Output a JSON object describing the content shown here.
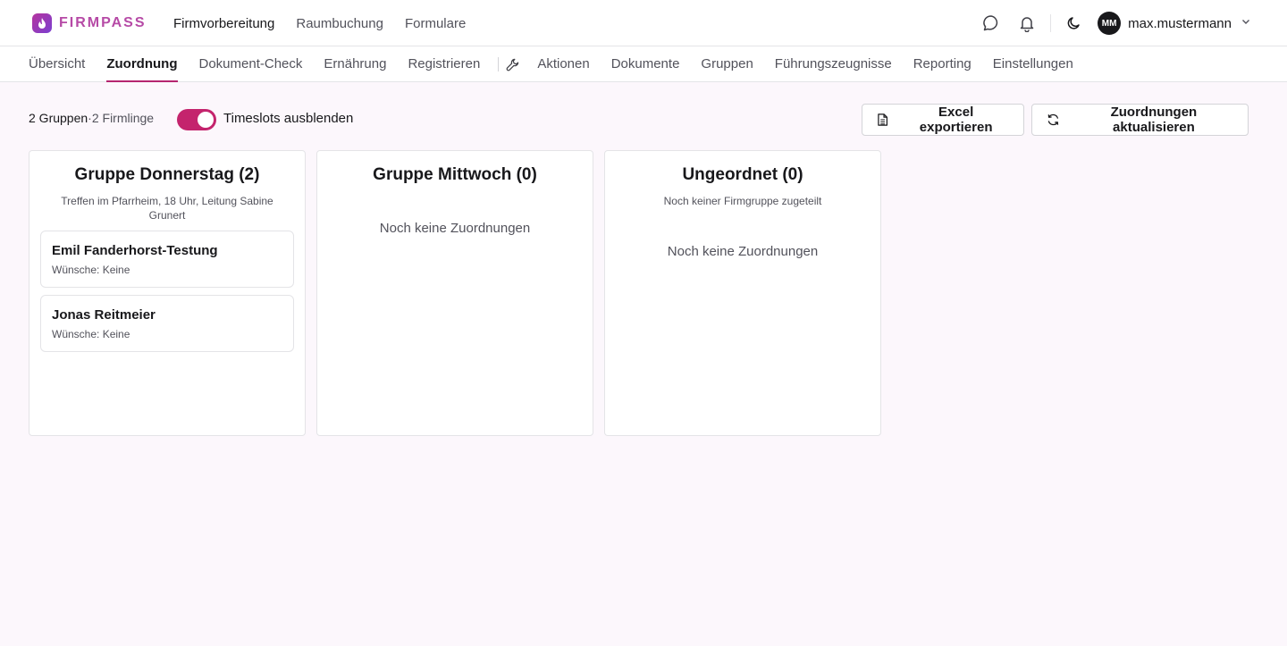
{
  "app": {
    "logo_text": "FIRMPASS",
    "accent_color": "#c4246d"
  },
  "main_nav": [
    {
      "label": "Firmvorbereitung",
      "active": true
    },
    {
      "label": "Raumbuchung",
      "active": false
    },
    {
      "label": "Formulare",
      "active": false
    }
  ],
  "user": {
    "initials": "MM",
    "name": "max.mustermann"
  },
  "sub_nav": {
    "primary": [
      {
        "label": "Übersicht",
        "active": false
      },
      {
        "label": "Zuordnung",
        "active": true
      },
      {
        "label": "Dokument-Check",
        "active": false
      },
      {
        "label": "Ernährung",
        "active": false
      },
      {
        "label": "Registrieren",
        "active": false
      }
    ],
    "admin": [
      {
        "label": "Aktionen"
      },
      {
        "label": "Dokumente"
      },
      {
        "label": "Gruppen"
      },
      {
        "label": "Führungszeugnisse"
      },
      {
        "label": "Reporting"
      },
      {
        "label": "Einstellungen"
      }
    ]
  },
  "toolbar": {
    "groups_count": "2 Gruppen",
    "separator": "·",
    "confirmands_count": "2 Firmlinge",
    "toggle_label": "Timeslots ausblenden",
    "toggle_on": true,
    "export_label": "Excel exportieren",
    "refresh_label": "Zuordnungen aktualisieren"
  },
  "columns": [
    {
      "title": "Gruppe Donnerstag (2)",
      "description": "Treffen im Pfarrheim, 18 Uhr, Leitung Sabine Grunert",
      "empty_text": "",
      "members": [
        {
          "name": "Emil Fanderhorst-Testung",
          "wishes": "Wünsche: Keine"
        },
        {
          "name": "Jonas Reitmeier",
          "wishes": "Wünsche: Keine"
        }
      ]
    },
    {
      "title": "Gruppe Mittwoch (0)",
      "description": "",
      "empty_text": "Noch keine Zuordnungen",
      "members": []
    },
    {
      "title": "Ungeordnet (0)",
      "description": "Noch keiner Firmgruppe zugeteilt",
      "empty_text": "Noch keine Zuordnungen",
      "members": []
    }
  ]
}
